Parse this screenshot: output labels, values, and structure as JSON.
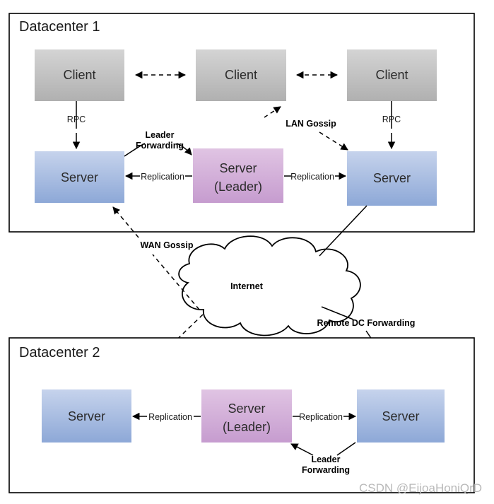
{
  "diagram": {
    "title_dc1": "Datacenter 1",
    "title_dc2": "Datacenter 2",
    "cloud_label": "Internet",
    "watermark": "CSDN @EijoaHoniQrD"
  },
  "datacenter1": {
    "clients": [
      {
        "label": "Client"
      },
      {
        "label": "Client"
      },
      {
        "label": "Client"
      }
    ],
    "servers": [
      {
        "label": "Server",
        "role": "follower"
      },
      {
        "label": "Server\n(Leader)",
        "line1": "Server",
        "line2": "(Leader)",
        "role": "leader"
      },
      {
        "label": "Server",
        "role": "follower"
      }
    ],
    "edges": [
      {
        "label": "RPC",
        "from": "client-1",
        "to": "server-1",
        "style": "solid"
      },
      {
        "label": "RPC",
        "from": "client-3",
        "to": "server-3",
        "style": "solid"
      },
      {
        "label": "LAN Gossip",
        "from": "client-2",
        "to": "server-3",
        "style": "dashed"
      },
      {
        "label": "Leader Forwarding",
        "line1": "Leader",
        "line2": "Forwarding",
        "from": "server-1",
        "to": "leader",
        "style": "solid"
      },
      {
        "label": "Replication",
        "from": "leader",
        "to": "server-1",
        "style": "solid"
      },
      {
        "label": "Replication",
        "from": "leader",
        "to": "server-3",
        "style": "solid"
      }
    ],
    "client_gossip_label": "LAN Gossip"
  },
  "datacenter2": {
    "servers": [
      {
        "label": "Server",
        "role": "follower"
      },
      {
        "label": "Server\n(Leader)",
        "line1": "Server",
        "line2": "(Leader)",
        "role": "leader"
      },
      {
        "label": "Server",
        "role": "follower"
      }
    ],
    "edges": [
      {
        "label": "Replication",
        "from": "leader",
        "to": "server-1",
        "style": "solid"
      },
      {
        "label": "Replication",
        "from": "leader",
        "to": "server-3",
        "style": "solid"
      },
      {
        "label": "Leader Forwarding",
        "line1": "Leader",
        "line2": "Forwarding",
        "from": "server-3",
        "to": "leader",
        "style": "solid"
      }
    ]
  },
  "cross_dc_edges": [
    {
      "label": "WAN Gossip",
      "style": "dashed"
    },
    {
      "label": "Remote DC Forwarding",
      "style": "solid"
    }
  ],
  "colors": {
    "client_fill_top": "#d0d0d0",
    "client_fill_bottom": "#b3b3b3",
    "server_fill_top": "#c2d0ea",
    "server_fill_bottom": "#8fa9d8",
    "leader_fill_top": "#ddbfe0",
    "leader_fill_bottom": "#c79ed0",
    "frame_stroke": "#000000",
    "background": "#ffffff",
    "watermark": "#b9b9b9"
  }
}
